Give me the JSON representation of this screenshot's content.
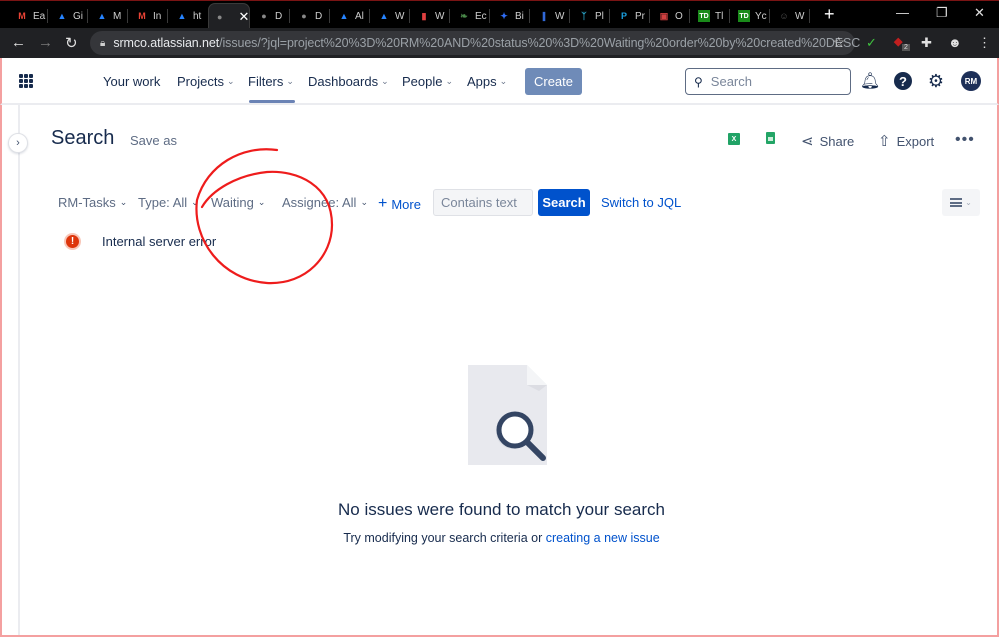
{
  "browser": {
    "tabs": [
      {
        "label": "Ea",
        "icon": "gmail-icon",
        "color": "#ea4335"
      },
      {
        "label": "Gi",
        "icon": "atlassian-icon",
        "color": "#2684ff"
      },
      {
        "label": "M",
        "icon": "atlassian-icon",
        "color": "#2684ff"
      },
      {
        "label": "In",
        "icon": "gmail-icon",
        "color": "#ea4335"
      },
      {
        "label": "ht",
        "icon": "atlassian-icon",
        "color": "#2684ff"
      },
      {
        "label": "",
        "icon": "loading-icon",
        "color": "#888888",
        "active": true
      },
      {
        "label": "D",
        "icon": "loading-icon",
        "color": "#888888"
      },
      {
        "label": "D",
        "icon": "loading-icon",
        "color": "#888888"
      },
      {
        "label": "Al",
        "icon": "atlassian-icon",
        "color": "#2684ff"
      },
      {
        "label": "W",
        "icon": "atlassian-icon",
        "color": "#2684ff"
      },
      {
        "label": "W",
        "icon": "document-icon",
        "color": "#e04040"
      },
      {
        "label": "Ec",
        "icon": "leaf-icon",
        "color": "#4a8a4a"
      },
      {
        "label": "Bi",
        "icon": "sparkle-icon",
        "color": "#2f6df6"
      },
      {
        "label": "W",
        "icon": "wave-icon",
        "color": "#3a7bff"
      },
      {
        "label": "Pl",
        "icon": "tower-icon",
        "color": "#2aa4c8"
      },
      {
        "label": "Pr",
        "icon": "p-icon",
        "color": "#1aa0e0"
      },
      {
        "label": "O",
        "icon": "calendar-icon",
        "color": "#d04040"
      },
      {
        "label": "Tl",
        "icon": "td-icon",
        "color": "#1a8a1a"
      },
      {
        "label": "Yc",
        "icon": "td-icon",
        "color": "#1a8a1a"
      },
      {
        "label": "W",
        "icon": "person-icon",
        "color": "#555555"
      }
    ],
    "url_host": "srmco.atlassian.net",
    "url_path": "/issues/?jql=project%20%3D%20RM%20AND%20status%20%3D%20Waiting%20order%20by%20created%20DESC",
    "extension_badge": "2"
  },
  "nav": {
    "items": [
      {
        "label": "Your work",
        "dropdown": false
      },
      {
        "label": "Projects",
        "dropdown": true
      },
      {
        "label": "Filters",
        "dropdown": true,
        "active": true
      },
      {
        "label": "Dashboards",
        "dropdown": true
      },
      {
        "label": "People",
        "dropdown": true
      },
      {
        "label": "Apps",
        "dropdown": true
      }
    ],
    "create_label": "Create",
    "search_placeholder": "Search",
    "avatar_initials": "RM"
  },
  "header": {
    "title": "Search",
    "save_as": "Save as",
    "share_label": "Share",
    "export_label": "Export",
    "excel_label": "X"
  },
  "filters": {
    "project": "RM-Tasks",
    "type": "Type: All",
    "status": "Waiting",
    "assignee": "Assignee: All",
    "more": "More",
    "text_placeholder": "Contains text",
    "search_button": "Search",
    "switch_jql": "Switch to JQL"
  },
  "error": {
    "message": "Internal server error"
  },
  "empty_state": {
    "title": "No issues were found to match your search",
    "subtitle": "Try modifying your search criteria or ",
    "link": "creating a new issue"
  },
  "colors": {
    "brand_blue": "#0052cc",
    "nav_text": "#172b4d",
    "error_red": "#de350b",
    "annotation_red": "#ee1c1c"
  }
}
